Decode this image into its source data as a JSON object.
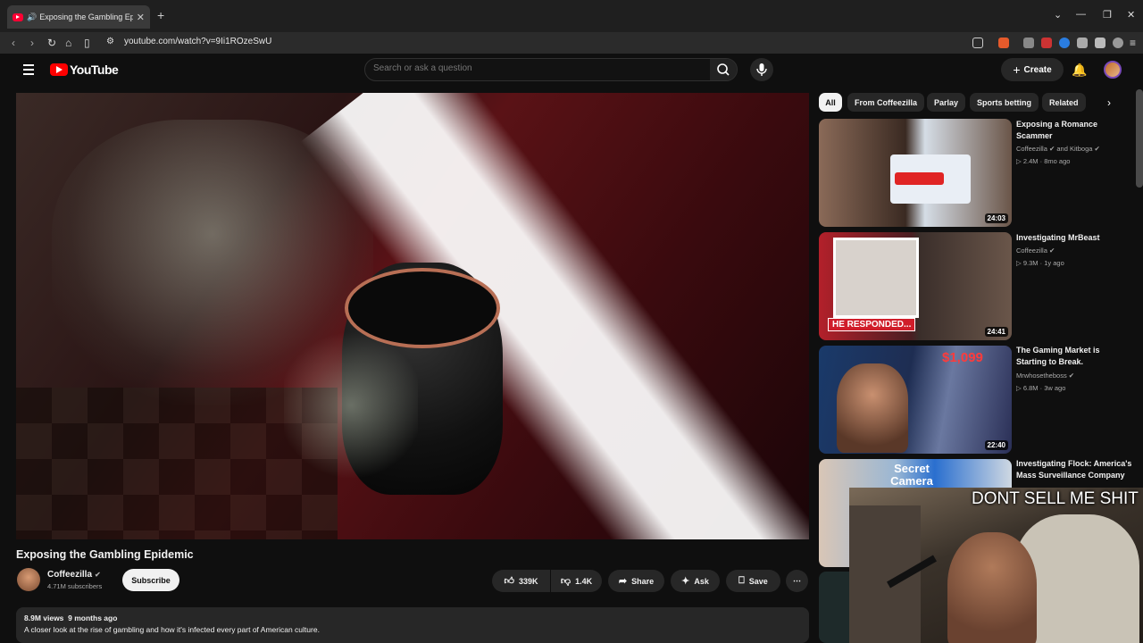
{
  "browser": {
    "tab_title": "Exposing the Gambling Epide",
    "url": "youtube.com/watch?v=9Ii1ROzeSwU"
  },
  "youtube": {
    "logo": "YouTube",
    "search_placeholder": "Search or ask a question",
    "create_label": "Create"
  },
  "video": {
    "title": "Exposing the Gambling Epidemic",
    "channel": "Coffeezilla",
    "subscribers": "4.71M subscribers",
    "subscribe_label": "Subscribe",
    "likes": "339K",
    "dislikes": "1.4K",
    "share_label": "Share",
    "ask_label": "Ask",
    "save_label": "Save",
    "views": "8.9M views",
    "posted": "9 months ago",
    "description": "A closer look at the rise of gambling and how it's infected every part of American culture."
  },
  "chips": [
    "All",
    "From Coffeezilla",
    "Parlay",
    "Sports betting",
    "Related"
  ],
  "recommendations": [
    {
      "title": "Exposing a Romance Scammer",
      "channel": "Coffeezilla",
      "channel_extra": "and Kitboga",
      "views": "2.4M",
      "age": "8mo ago",
      "duration": "24:03",
      "thumb_text": ""
    },
    {
      "title": "Investigating MrBeast",
      "channel": "Coffeezilla",
      "channel_extra": "",
      "views": "9.3M",
      "age": "1y ago",
      "duration": "24:41",
      "thumb_text": "HE RESPONDED..."
    },
    {
      "title": "The Gaming Market is Starting to Break.",
      "channel": "Mrwhosetheboss",
      "channel_extra": "",
      "views": "6.8M",
      "age": "3w ago",
      "duration": "22:40",
      "thumb_text": "$1,099"
    },
    {
      "title": "Investigating Flock: America's Mass Surveillance Company",
      "channel": "",
      "channel_extra": "",
      "views": "",
      "age": "",
      "duration": "",
      "thumb_text": "Secret Camera"
    }
  ],
  "overlay_text": "DONT SELL ME SHIT"
}
